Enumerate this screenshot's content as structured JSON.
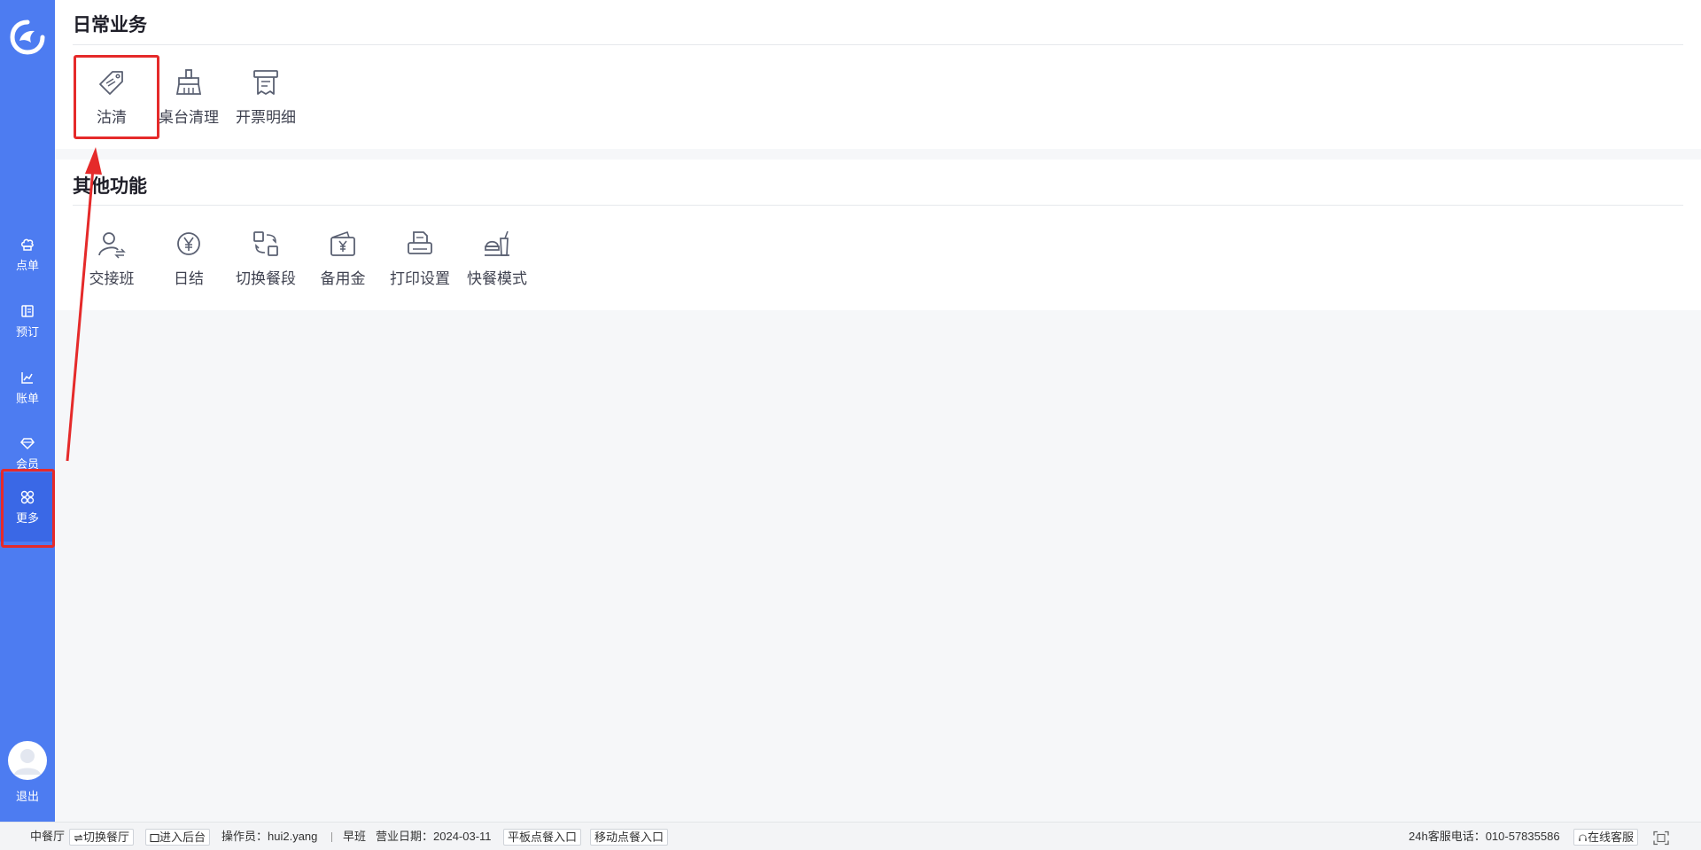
{
  "sidebar": {
    "logo": "brand-logo",
    "items": [
      {
        "label": "点单",
        "icon": "chef-hat-icon"
      },
      {
        "label": "预订",
        "icon": "book-icon"
      },
      {
        "label": "账单",
        "icon": "line-chart-icon"
      },
      {
        "label": "会员",
        "icon": "diamond-icon"
      },
      {
        "label": "更多",
        "icon": "grid-icon",
        "active": true
      }
    ],
    "logout_label": "退出"
  },
  "daily": {
    "title": "日常业务",
    "items": [
      {
        "label": "沽清",
        "icon": "tag-icon"
      },
      {
        "label": "桌台清理",
        "icon": "broom-icon"
      },
      {
        "label": "开票明细",
        "icon": "receipt-icon"
      }
    ]
  },
  "other": {
    "title": "其他功能",
    "items": [
      {
        "label": "交接班",
        "icon": "user-exchange-icon"
      },
      {
        "label": "日结",
        "icon": "yen-coin-icon"
      },
      {
        "label": "切换餐段",
        "icon": "switch-icon"
      },
      {
        "label": "备用金",
        "icon": "wallet-yen-icon"
      },
      {
        "label": "打印设置",
        "icon": "printer-icon"
      },
      {
        "label": "快餐模式",
        "icon": "fast-food-icon"
      }
    ]
  },
  "statusbar": {
    "restaurant": "中餐厅",
    "switch_restaurant": "切换餐厅",
    "enter_backend": "进入后台",
    "operator": "操作员：hui2.yang",
    "shift": "早班",
    "business_date": "营业日期：2024-03-11",
    "tablet_order": "平板点餐入口",
    "mobile_order": "移动点餐入口",
    "hotline": "24h客服电话：010-57835586",
    "online_service": "在线客服"
  },
  "colors": {
    "sidebar_bg": "#4d7cf1",
    "sidebar_active": "#3a68e6",
    "highlight": "#e52a2a"
  }
}
